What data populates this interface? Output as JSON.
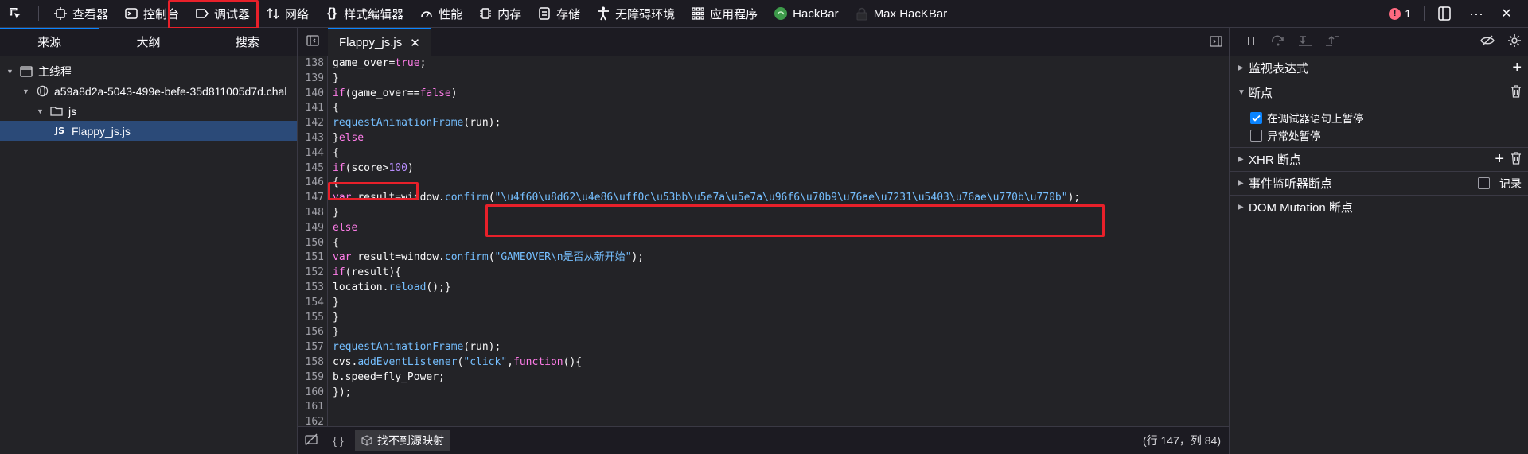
{
  "toolbar": {
    "tabs": [
      {
        "label": "查看器",
        "icon": "inspector-icon"
      },
      {
        "label": "控制台",
        "icon": "console-icon"
      },
      {
        "label": "调试器",
        "icon": "debugger-icon"
      },
      {
        "label": "网络",
        "icon": "network-icon"
      },
      {
        "label": "样式编辑器",
        "icon": "style-editor-icon"
      },
      {
        "label": "性能",
        "icon": "performance-icon"
      },
      {
        "label": "内存",
        "icon": "memory-icon"
      },
      {
        "label": "存储",
        "icon": "storage-icon"
      },
      {
        "label": "无障碍环境",
        "icon": "accessibility-icon"
      },
      {
        "label": "应用程序",
        "icon": "application-icon"
      },
      {
        "label": "HackBar",
        "icon": "hackbar-icon"
      },
      {
        "label": "Max HacKBar",
        "icon": "max-hackbar-icon"
      }
    ],
    "selected": "调试器",
    "error_count": "1",
    "accent": "#0a84ff",
    "highlight_color": "#e8202a"
  },
  "sources": {
    "tabs": [
      "来源",
      "大纲",
      "搜索"
    ],
    "selected_tab": "来源",
    "tree": {
      "thread": "主线程",
      "origin": "a59a8d2a-5043-499e-befe-35d811005d7d.chal",
      "folder": "js",
      "file_badge": "JS",
      "file": "Flappy_js.js"
    }
  },
  "editor": {
    "tab_label": "Flappy_js.js",
    "close_glyph": "✕",
    "line_numbers": [
      "138",
      "139",
      "140",
      "141",
      "142",
      "143",
      "144",
      "145",
      "146",
      "147",
      "148",
      "149",
      "150",
      "151",
      "152",
      "153",
      "154",
      "155",
      "156",
      "157",
      "158",
      "159",
      "160",
      "161",
      "162"
    ],
    "lines": [
      "game_over=true;",
      "}",
      "if(game_over==false)",
      "{",
      "requestAnimationFrame(run);",
      "}else",
      "{",
      "if(score>100)",
      "{",
      "var result=window.confirm(\"\\u4f60\\u8d62\\u4e86\\uff0c\\u53bb\\u5e7a\\u5e7a\\u96f6\\u70b9\\u76ae\\u7231\\u5403\\u76ae\\u770b\\u770b\");",
      "}",
      "else",
      "{",
      "var result=window.confirm(\"GAMEOVER\\n是否从新开始\");",
      "if(result){",
      "location.reload();}",
      "}",
      "}",
      "}",
      "requestAnimationFrame(run);",
      "cvs.addEventListener(\"click\",function(){",
      "b.speed=fly_Power;",
      "});",
      "",
      ""
    ],
    "status": {
      "braces": "{ }",
      "no_source_map": "找不到源映射",
      "cursor_position": "(行 147，列 84)"
    }
  },
  "debugger_panel": {
    "watch_label": "监视表达式",
    "breakpoints_label": "断点",
    "pause_on_debugger_statement": {
      "label": "在调试器语句上暂停",
      "checked": true
    },
    "pause_on_exceptions": {
      "label": "异常处暂停",
      "checked": false
    },
    "xhr_label": "XHR 断点",
    "event_listener_label": "事件监听器断点",
    "log_label": "记录",
    "dom_mutation_label": "DOM Mutation 断点"
  }
}
